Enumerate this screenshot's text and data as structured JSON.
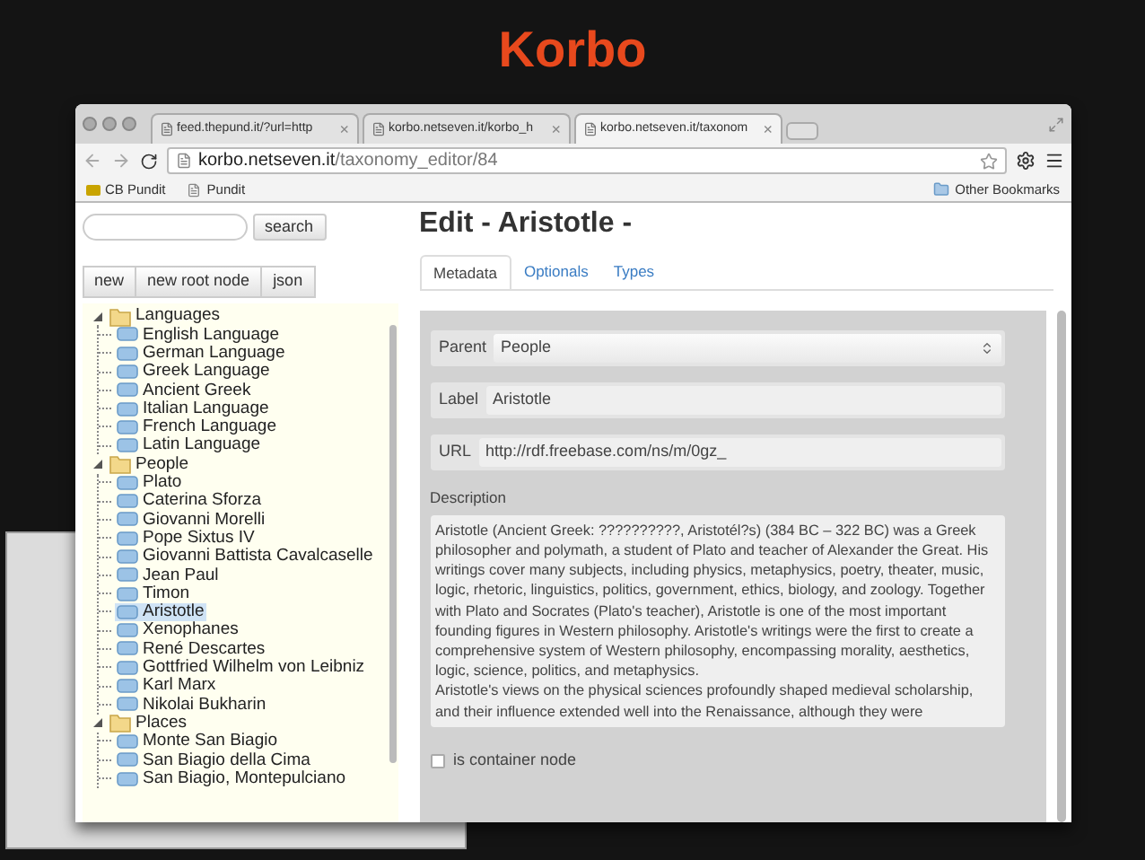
{
  "slide": {
    "title": "Korbo"
  },
  "browser": {
    "tabs": [
      {
        "title": "feed.thepund.it/?url=http",
        "close": "×",
        "selected": false
      },
      {
        "title": "korbo.netseven.it/korbo_h",
        "close": "×",
        "selected": false
      },
      {
        "title": "korbo.netseven.it/taxonom",
        "close": "×",
        "selected": true
      }
    ],
    "address": {
      "host": "korbo.netseven.it",
      "path": "/taxonomy_editor/84"
    },
    "bookmarks": [
      {
        "kind": "pundit",
        "label": "CB Pundit"
      },
      {
        "kind": "page",
        "label": "Pundit"
      }
    ],
    "other_bookmarks": "Other Bookmarks"
  },
  "sidebar": {
    "search_button": "search",
    "buttons": [
      "new",
      "new root node",
      "json"
    ],
    "tree": [
      {
        "label": "Languages",
        "expanded": true,
        "children": [
          {
            "label": "English Language",
            "selected": false
          },
          {
            "label": "German Language",
            "selected": false
          },
          {
            "label": "Greek Language",
            "selected": false
          },
          {
            "label": "Ancient Greek",
            "selected": false
          },
          {
            "label": "Italian Language",
            "selected": false
          },
          {
            "label": "French Language",
            "selected": false
          },
          {
            "label": "Latin Language",
            "selected": false
          }
        ]
      },
      {
        "label": "People",
        "expanded": true,
        "children": [
          {
            "label": "Plato",
            "selected": false
          },
          {
            "label": "Caterina Sforza",
            "selected": false
          },
          {
            "label": "Giovanni Morelli",
            "selected": false
          },
          {
            "label": "Pope Sixtus IV",
            "selected": false
          },
          {
            "label": "Giovanni Battista Cavalcaselle",
            "selected": false
          },
          {
            "label": "Jean Paul",
            "selected": false
          },
          {
            "label": "Timon",
            "selected": false
          },
          {
            "label": "Aristotle",
            "selected": true
          },
          {
            "label": "Xenophanes",
            "selected": false
          },
          {
            "label": "René Descartes",
            "selected": false
          },
          {
            "label": "Gottfried Wilhelm von Leibniz",
            "selected": false
          },
          {
            "label": "Karl Marx",
            "selected": false
          },
          {
            "label": "Nikolai Bukharin",
            "selected": false
          }
        ]
      },
      {
        "label": "Places",
        "expanded": true,
        "children": [
          {
            "label": "Monte San Biagio",
            "selected": false
          },
          {
            "label": "San Biagio della Cima",
            "selected": false
          },
          {
            "label": "San Biagio, Montepulciano",
            "selected": false
          }
        ]
      }
    ]
  },
  "editor": {
    "heading": "Edit - Aristotle -",
    "tabs": [
      {
        "label": "Metadata",
        "selected": true
      },
      {
        "label": "Optionals",
        "selected": false
      },
      {
        "label": "Types",
        "selected": false
      }
    ],
    "fields": [
      {
        "kind": "select",
        "label": "Parent",
        "value": "People"
      },
      {
        "kind": "text",
        "label": "Label",
        "value": "Aristotle"
      },
      {
        "kind": "text",
        "label": "URL",
        "value": "http://rdf.freebase.com/ns/m/0gz_"
      }
    ],
    "description": {
      "label": "Description",
      "paragraphs": [
        "Aristotle (Ancient Greek: ??????????, Aristotél?s) (384 BC – 322 BC) was a Greek philosopher and polymath, a student of Plato and teacher of Alexander the Great. His writings cover many subjects, including physics, metaphysics, poetry, theater, music, logic, rhetoric, linguistics, politics, government, ethics, biology, and zoology. Together with Plato and Socrates (Plato's teacher), Aristotle is one of the most important founding figures in Western philosophy. Aristotle's writings were the first to create a comprehensive system of Western philosophy, encompassing morality, aesthetics, logic, science, politics, and metaphysics.",
        "Aristotle's views on the physical sciences profoundly shaped medieval scholarship, and their influence extended well into the Renaissance, although they were"
      ]
    },
    "container_checkbox": {
      "label": "is container node",
      "checked": false
    }
  }
}
